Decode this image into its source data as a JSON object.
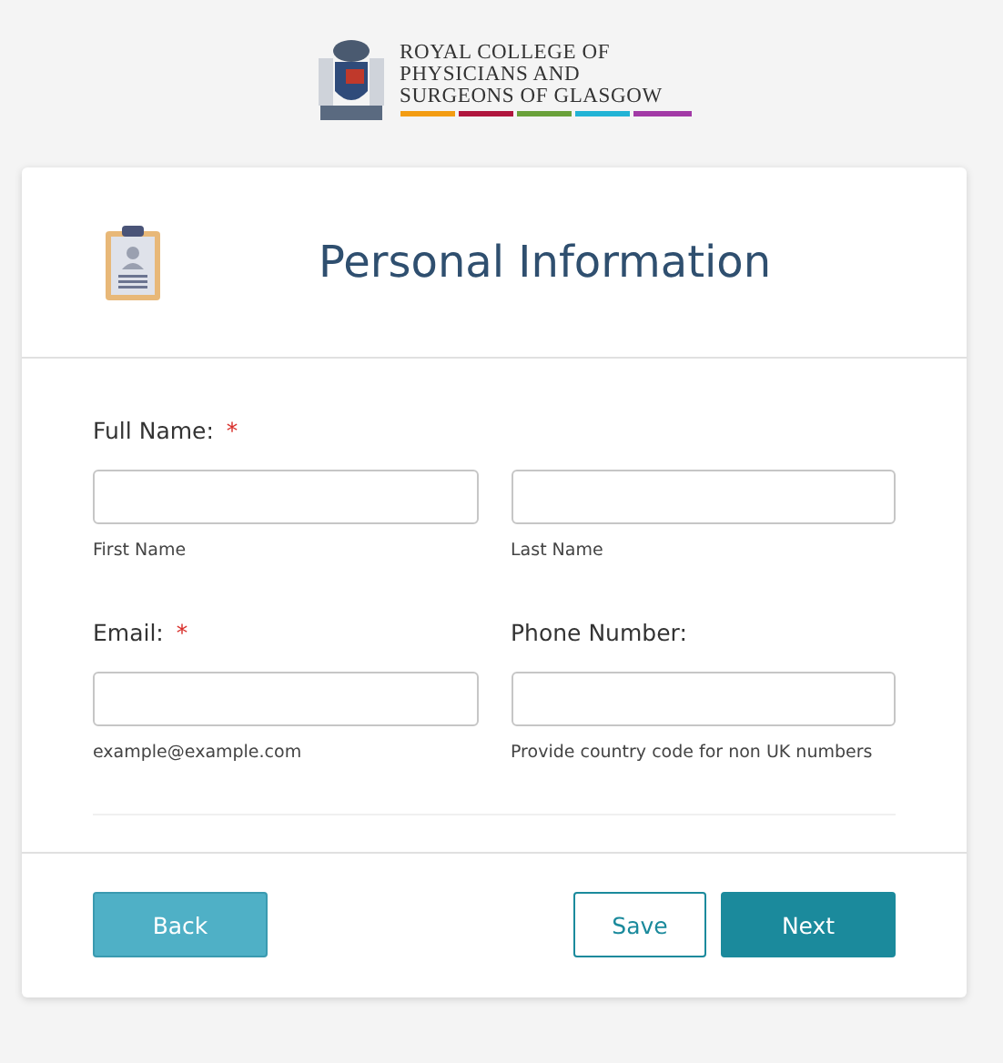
{
  "logo": {
    "lines": [
      "ROYAL COLLEGE OF",
      "PHYSICIANS AND",
      "SURGEONS OF GLASGOW"
    ]
  },
  "header": {
    "title": "Personal Information"
  },
  "rows": [
    {
      "groups": [
        {
          "label": "Full Name:",
          "required_mark": "*",
          "inputs": [
            {
              "hint": "First Name"
            },
            {
              "hint": "Last Name"
            }
          ]
        }
      ]
    },
    {
      "groups": [
        {
          "label": "Email:",
          "required_mark": "*",
          "inputs": [
            {
              "hint": "example@example.com"
            }
          ]
        },
        {
          "label": "Phone Number:",
          "inputs": [
            {
              "hint": "Provide country code for non UK numbers"
            }
          ]
        }
      ]
    }
  ],
  "buttons": [
    {
      "label": "Back",
      "kind": "secondary"
    },
    {
      "label": "Save",
      "kind": "outline"
    },
    {
      "label": "Next",
      "kind": "primary"
    }
  ]
}
